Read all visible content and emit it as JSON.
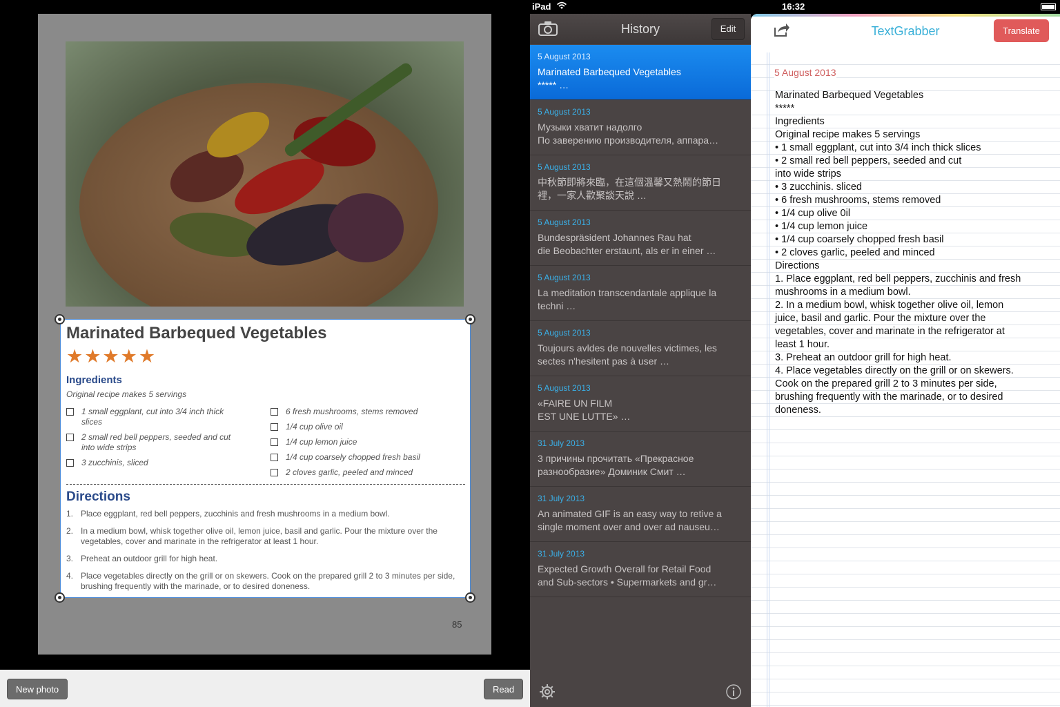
{
  "status_bar": {
    "carrier": "iPad",
    "time": "16:32"
  },
  "preview": {
    "recipe_title": "Marinated Barbequed Vegetables",
    "stars": "★★★★★",
    "ingredients_heading": "Ingredients",
    "ingredients_sub": "Original recipe makes 5 servings",
    "ingredients_col1": [
      "1 small eggplant, cut into 3/4 inch thick slices",
      "2 small red bell peppers, seeded and cut into wide strips",
      "3 zucchinis, sliced"
    ],
    "ingredients_col2": [
      "6 fresh mushrooms, stems removed",
      "1/4 cup olive oil",
      "1/4 cup lemon juice",
      "1/4 cup coarsely chopped fresh basil",
      "2 cloves garlic, peeled and minced"
    ],
    "directions_heading": "Directions",
    "directions": [
      {
        "num": "1.",
        "text": "Place eggplant, red bell peppers, zucchinis and fresh mushrooms in a medium bowl."
      },
      {
        "num": "2.",
        "text": "In a medium bowl, whisk together olive oil, lemon juice, basil and garlic. Pour the mixture over the vegetables, cover and marinate in the refrigerator at least 1 hour."
      },
      {
        "num": "3.",
        "text": "Preheat an outdoor grill for high heat."
      },
      {
        "num": "4.",
        "text": "Place vegetables directly on the grill or on skewers. Cook on the prepared grill 2 to 3 minutes per side, brushing frequently with the marinade, or to desired doneness."
      }
    ],
    "page_number": "85"
  },
  "bottom_bar": {
    "new_photo": "New photo",
    "read": "Read"
  },
  "history": {
    "title": "History",
    "edit": "Edit",
    "items": [
      {
        "date": "5 August 2013",
        "line1": "Marinated Barbequed Vegetables",
        "line2": "***** …"
      },
      {
        "date": "5 August 2013",
        "line1": "Музыки хватит надолго",
        "line2": "По заверению производителя, аппара…"
      },
      {
        "date": "5 August 2013",
        "line1": "中秋節即將來臨，在這個溫馨又熱鬧的節日",
        "line2": "裡，一家人歡聚談天說 …"
      },
      {
        "date": "5 August 2013",
        "line1": "Bundespräsident Johannes Rau hat",
        "line2": "die Beobachter erstaunt, als er in einer …"
      },
      {
        "date": "5 August 2013",
        "line1": "La meditation transcendantale applique la",
        "line2": "techni …"
      },
      {
        "date": "5 August 2013",
        "line1": "Toujours avldes de nouvelles victimes, les",
        "line2": "sectes n'hesitent pas à user …"
      },
      {
        "date": "5 August 2013",
        "line1": "«FAIRE UN FILM",
        "line2": "EST UNE LUTTE» …"
      },
      {
        "date": "31 July 2013",
        "line1": "3 причины прочитать «Прекрасное",
        "line2": "разнообразие» Доминик Смит …"
      },
      {
        "date": "31 July 2013",
        "line1": "An animated GIF is an easy way to retive a",
        "line2": "single moment over and over ad nauseu…"
      },
      {
        "date": "31 July 2013",
        "line1": "Expected Growth Overall for Retail Food",
        "line2": "and Sub-sectors • Supermarkets and gr…"
      }
    ]
  },
  "note": {
    "app_title": "TextGrabber",
    "translate": "Translate",
    "date": "5 August 2013",
    "lines": [
      "Marinated Barbequed Vegetables",
      "*****",
      "Ingredients",
      "Original recipe makes 5 servings",
      "• 1 small eggplant, cut into 3/4 inch thick slices",
      "• 2 small red bell peppers, seeded and cut",
      "into wide strips",
      "• 3 zucchinis. sliced",
      "• 6 fresh mushrooms, stems removed",
      "• 1/4 cup olive 0il",
      "• 1/4 cup lemon juice",
      "• 1/4 cup coarsely chopped fresh basil",
      "• 2 cloves garlic, peeled and minced",
      "Directions",
      "1. Place eggplant, red bell peppers, zucchinis and fresh",
      "mushrooms in a medium bowl.",
      "2. In a medium bowl, whisk together olive oil, lemon",
      "juice, basil and garlic. Pour the mixture over the",
      "vegetables, cover and marinate in the refrigerator at",
      "least 1 hour.",
      "3. Preheat an outdoor grill for high heat.",
      "4. Place vegetables directly on the grill or on skewers.",
      "Cook on the prepared grill 2 to 3 minutes per side,",
      "brushing frequently with the marinade, or to desired",
      "doneness."
    ]
  }
}
